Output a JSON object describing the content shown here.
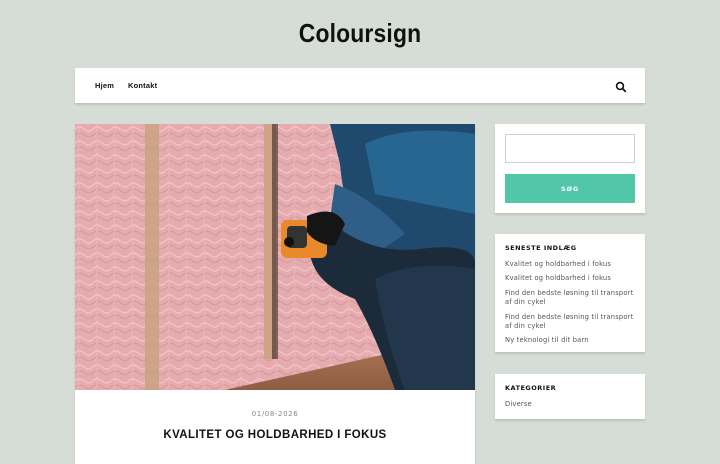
{
  "site": {
    "title": "Coloursign"
  },
  "nav": {
    "items": [
      {
        "label": "Hjem"
      },
      {
        "label": "Kontakt"
      }
    ],
    "search_icon": "search-icon"
  },
  "post": {
    "image_icon": "post-photo",
    "date": "01/08-2026",
    "title": "KVALITET OG HOLDBARHED I FOKUS"
  },
  "sidebar": {
    "search": {
      "placeholder": "",
      "button_label": "SØG",
      "button_color": "#52c6a8"
    },
    "recent": {
      "title": "SENESTE INDLÆG",
      "items": [
        {
          "label": "Kvalitet og holdbarhed i fokus"
        },
        {
          "label": "Kvalitet og holdbarhed i fokus"
        },
        {
          "label": "Find den bedste løsning til transport af din cykel"
        },
        {
          "label": "Find den bedste løsning til transport af din cykel"
        },
        {
          "label": "Ny teknologi til dit barn"
        }
      ]
    },
    "categories": {
      "title": "KATEGORIER",
      "items": [
        {
          "label": "Diverse"
        }
      ]
    }
  }
}
